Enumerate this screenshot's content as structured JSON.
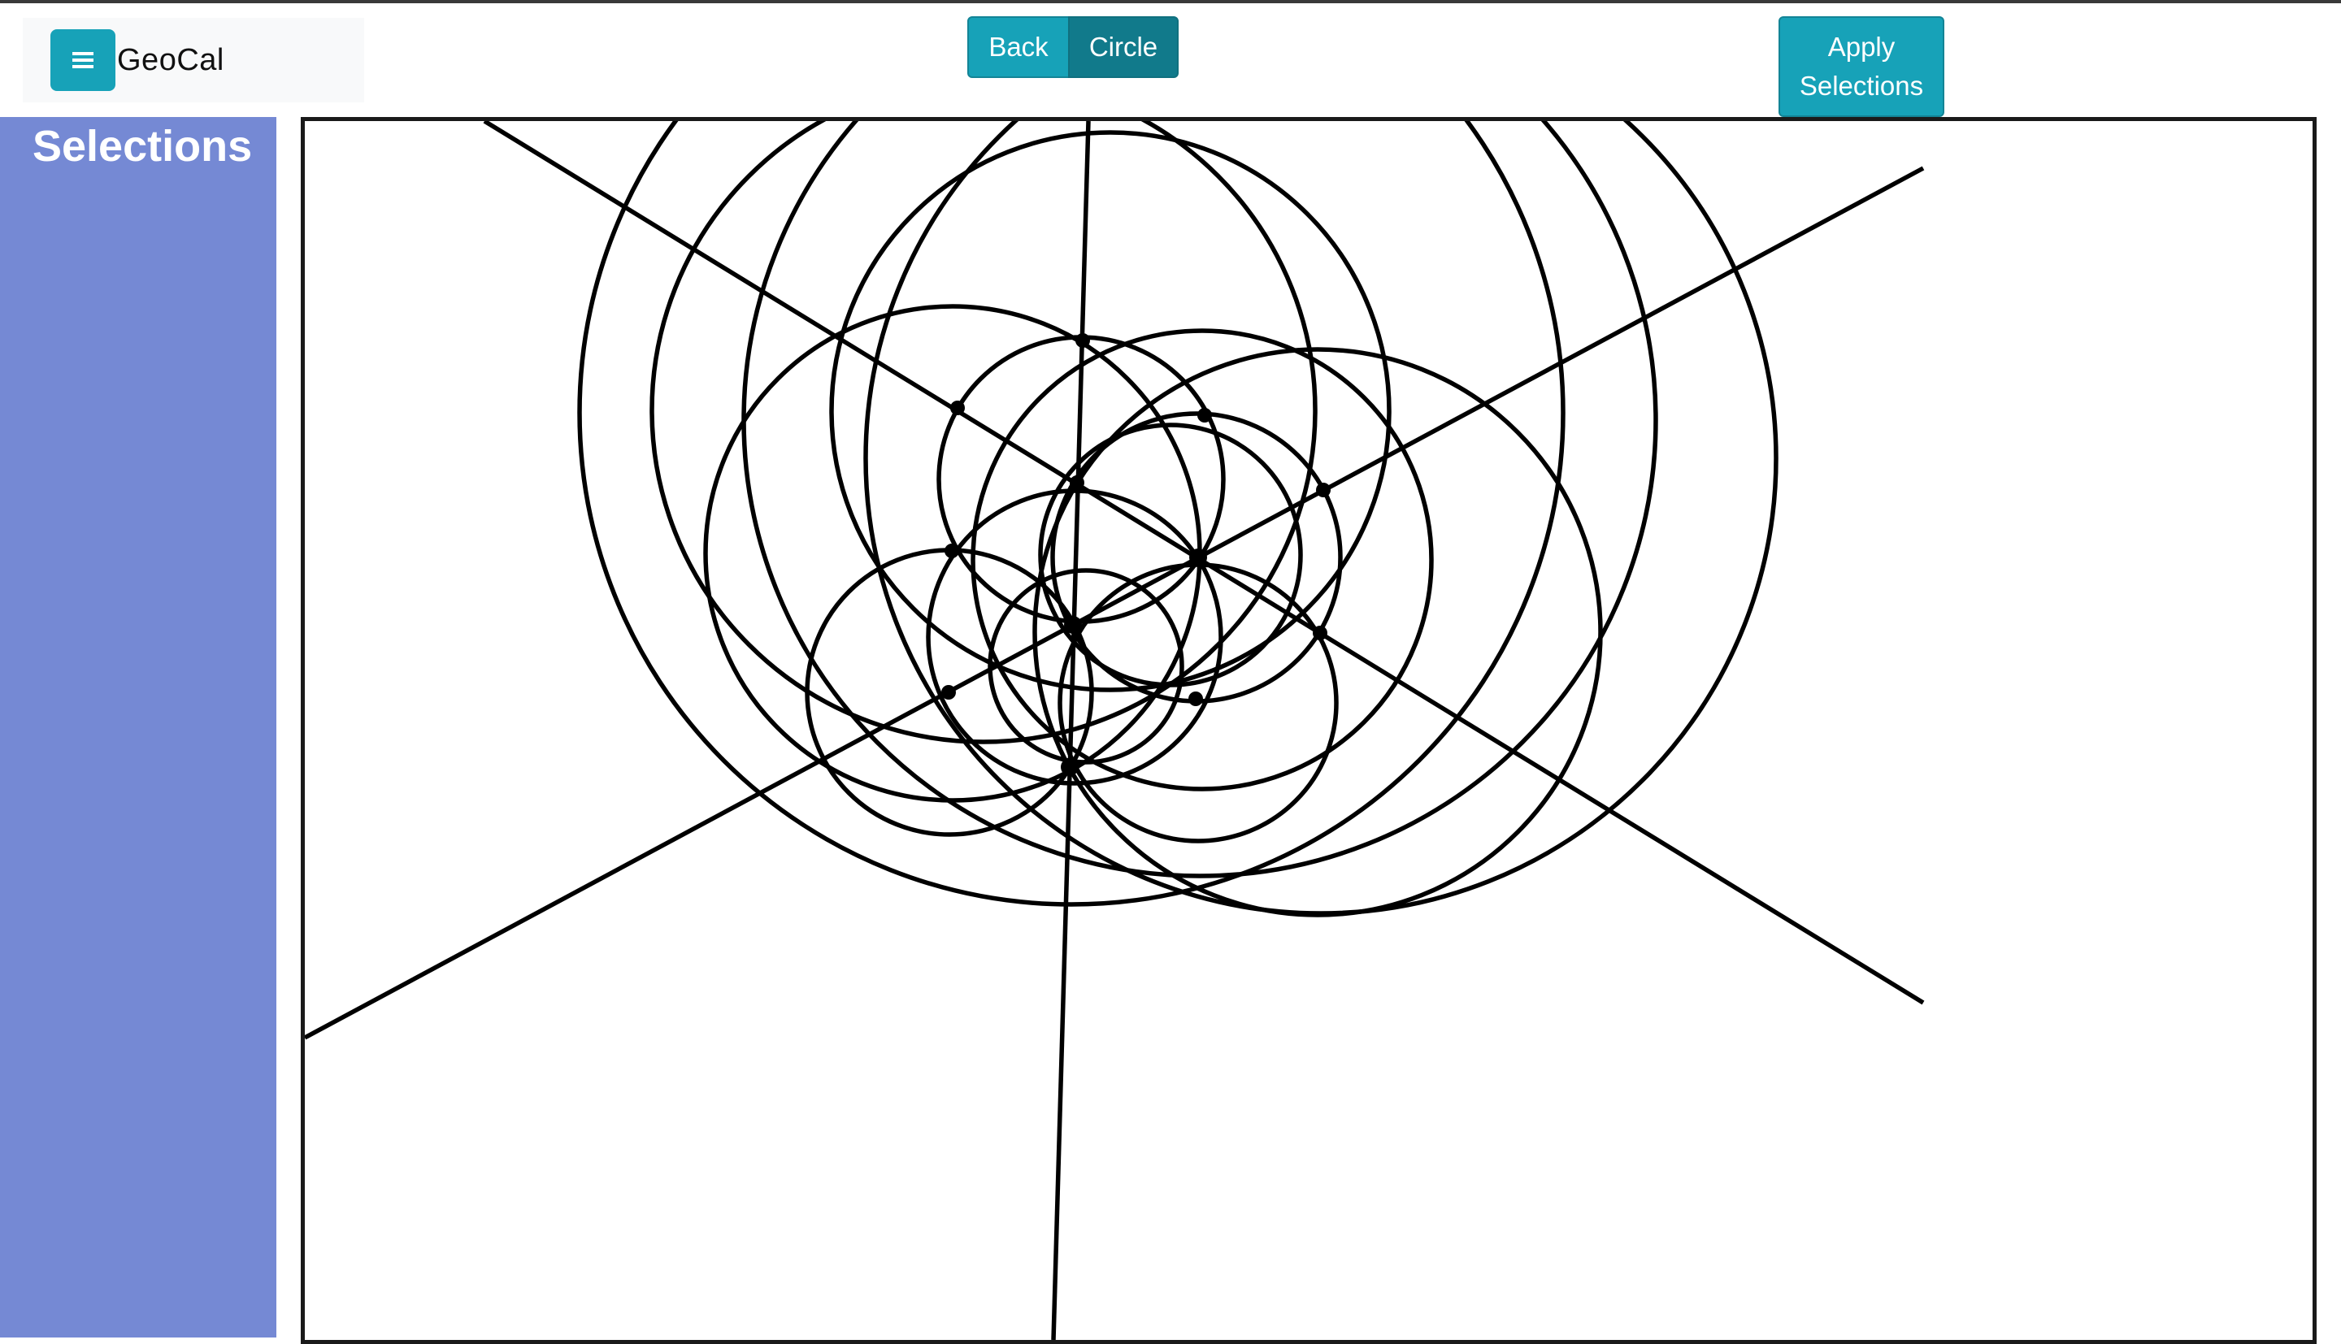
{
  "app": {
    "title": "GeoCal",
    "menu_icon": "hamburger-icon",
    "accent_color": "#17a2b8",
    "sidebar_color": "#7589d4"
  },
  "toolbar": {
    "back_label": "Back",
    "circle_label": "Circle",
    "apply_label": "Apply Selections"
  },
  "sidebar": {
    "title": "Selections"
  }
}
